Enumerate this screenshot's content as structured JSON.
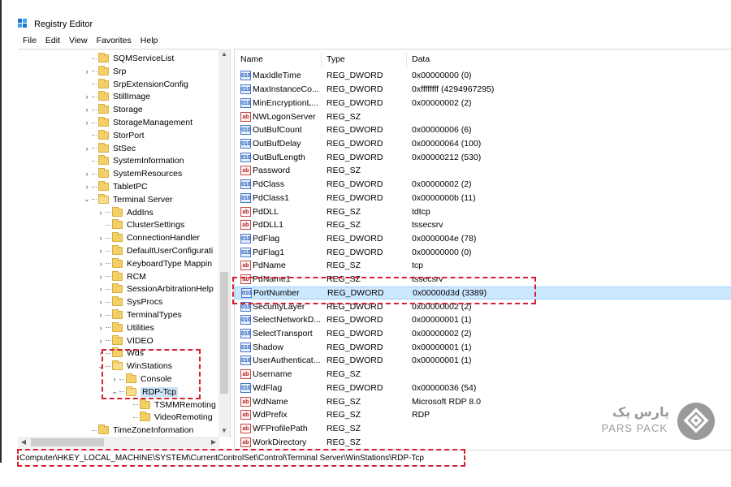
{
  "app": {
    "title": "Registry Editor"
  },
  "menu": [
    "File",
    "Edit",
    "View",
    "Favorites",
    "Help"
  ],
  "tree": {
    "items": [
      {
        "label": "SQMServiceList",
        "level": 1,
        "expander": ""
      },
      {
        "label": "Srp",
        "level": 1,
        "expander": ">"
      },
      {
        "label": "SrpExtensionConfig",
        "level": 1,
        "expander": ""
      },
      {
        "label": "StillImage",
        "level": 1,
        "expander": ">"
      },
      {
        "label": "Storage",
        "level": 1,
        "expander": ">"
      },
      {
        "label": "StorageManagement",
        "level": 1,
        "expander": ">"
      },
      {
        "label": "StorPort",
        "level": 1,
        "expander": ""
      },
      {
        "label": "StSec",
        "level": 1,
        "expander": ">"
      },
      {
        "label": "SystemInformation",
        "level": 1,
        "expander": ""
      },
      {
        "label": "SystemResources",
        "level": 1,
        "expander": ">"
      },
      {
        "label": "TabletPC",
        "level": 1,
        "expander": ">"
      },
      {
        "label": "Terminal Server",
        "level": 1,
        "expander": "v"
      },
      {
        "label": "AddIns",
        "level": 2,
        "expander": ">"
      },
      {
        "label": "ClusterSettings",
        "level": 2,
        "expander": ""
      },
      {
        "label": "ConnectionHandler",
        "level": 2,
        "expander": ">"
      },
      {
        "label": "DefaultUserConfigurati",
        "level": 2,
        "expander": ">"
      },
      {
        "label": "KeyboardType Mappin",
        "level": 2,
        "expander": ">"
      },
      {
        "label": "RCM",
        "level": 2,
        "expander": ">"
      },
      {
        "label": "SessionArbitrationHelp",
        "level": 2,
        "expander": ">"
      },
      {
        "label": "SysProcs",
        "level": 2,
        "expander": ">"
      },
      {
        "label": "TerminalTypes",
        "level": 2,
        "expander": ">"
      },
      {
        "label": "Utilities",
        "level": 2,
        "expander": ">"
      },
      {
        "label": "VIDEO",
        "level": 2,
        "expander": ">"
      },
      {
        "label": "Wds",
        "level": 2,
        "expander": ">"
      },
      {
        "label": "WinStations",
        "level": 2,
        "expander": "v"
      },
      {
        "label": "Console",
        "level": 3,
        "expander": ">"
      },
      {
        "label": "RDP-Tcp",
        "level": 3,
        "expander": "v"
      },
      {
        "label": "TSMMRemoting",
        "level": 4,
        "expander": ""
      },
      {
        "label": "VideoRemoting",
        "level": 4,
        "expander": ""
      },
      {
        "label": "TimeZoneInformation",
        "level": 1,
        "expander": ""
      }
    ],
    "selected": "RDP-Tcp"
  },
  "columns": {
    "name": "Name",
    "type": "Type",
    "data": "Data"
  },
  "values": [
    {
      "icon": "bin",
      "name": "MaxIdleTime",
      "type": "REG_DWORD",
      "data": "0x00000000 (0)"
    },
    {
      "icon": "bin",
      "name": "MaxInstanceCo...",
      "type": "REG_DWORD",
      "data": "0xffffffff (4294967295)"
    },
    {
      "icon": "bin",
      "name": "MinEncryptionL...",
      "type": "REG_DWORD",
      "data": "0x00000002 (2)"
    },
    {
      "icon": "str",
      "name": "NWLogonServer",
      "type": "REG_SZ",
      "data": ""
    },
    {
      "icon": "bin",
      "name": "OutBufCount",
      "type": "REG_DWORD",
      "data": "0x00000006 (6)"
    },
    {
      "icon": "bin",
      "name": "OutBufDelay",
      "type": "REG_DWORD",
      "data": "0x00000064 (100)"
    },
    {
      "icon": "bin",
      "name": "OutBufLength",
      "type": "REG_DWORD",
      "data": "0x00000212 (530)"
    },
    {
      "icon": "str",
      "name": "Password",
      "type": "REG_SZ",
      "data": ""
    },
    {
      "icon": "bin",
      "name": "PdClass",
      "type": "REG_DWORD",
      "data": "0x00000002 (2)"
    },
    {
      "icon": "bin",
      "name": "PdClass1",
      "type": "REG_DWORD",
      "data": "0x0000000b (11)"
    },
    {
      "icon": "str",
      "name": "PdDLL",
      "type": "REG_SZ",
      "data": "tdtcp"
    },
    {
      "icon": "str",
      "name": "PdDLL1",
      "type": "REG_SZ",
      "data": "tssecsrv"
    },
    {
      "icon": "bin",
      "name": "PdFlag",
      "type": "REG_DWORD",
      "data": "0x0000004e (78)"
    },
    {
      "icon": "bin",
      "name": "PdFlag1",
      "type": "REG_DWORD",
      "data": "0x00000000 (0)"
    },
    {
      "icon": "str",
      "name": "PdName",
      "type": "REG_SZ",
      "data": "tcp"
    },
    {
      "icon": "str",
      "name": "PdName1",
      "type": "REG_SZ",
      "data": "tssecsrv"
    },
    {
      "icon": "bin",
      "name": "PortNumber",
      "type": "REG_DWORD",
      "data": "0x00000d3d (3389)",
      "selected": true
    },
    {
      "icon": "bin",
      "name": "SecurityLayer",
      "type": "REG_DWORD",
      "data": "0x00000002 (2)"
    },
    {
      "icon": "bin",
      "name": "SelectNetworkD...",
      "type": "REG_DWORD",
      "data": "0x00000001 (1)"
    },
    {
      "icon": "bin",
      "name": "SelectTransport",
      "type": "REG_DWORD",
      "data": "0x00000002 (2)"
    },
    {
      "icon": "bin",
      "name": "Shadow",
      "type": "REG_DWORD",
      "data": "0x00000001 (1)"
    },
    {
      "icon": "bin",
      "name": "UserAuthenticat...",
      "type": "REG_DWORD",
      "data": "0x00000001 (1)"
    },
    {
      "icon": "str",
      "name": "Username",
      "type": "REG_SZ",
      "data": ""
    },
    {
      "icon": "bin",
      "name": "WdFlag",
      "type": "REG_DWORD",
      "data": "0x00000036 (54)"
    },
    {
      "icon": "str",
      "name": "WdName",
      "type": "REG_SZ",
      "data": "Microsoft RDP 8.0"
    },
    {
      "icon": "str",
      "name": "WdPrefix",
      "type": "REG_SZ",
      "data": "RDP"
    },
    {
      "icon": "str",
      "name": "WFProfilePath",
      "type": "REG_SZ",
      "data": ""
    },
    {
      "icon": "str",
      "name": "WorkDirectory",
      "type": "REG_SZ",
      "data": ""
    }
  ],
  "status": {
    "path": "Computer\\HKEY_LOCAL_MACHINE\\SYSTEM\\CurrentControlSet\\Control\\Terminal Server\\WinStations\\RDP-Tcp"
  },
  "watermark": {
    "fa": "پارس پک",
    "en": "PARS PACK"
  },
  "colors": {
    "highlight": "#d41f2e",
    "selection": "#cce8ff",
    "folder": "#f3cf6a"
  }
}
